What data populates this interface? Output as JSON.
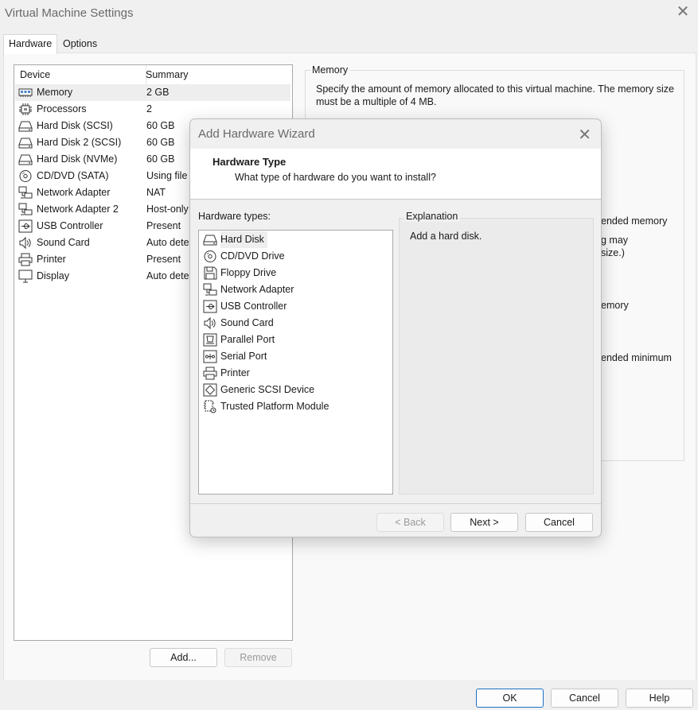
{
  "window": {
    "title": "Virtual Machine Settings"
  },
  "tabs": [
    {
      "label": "Hardware",
      "active": true
    },
    {
      "label": "Options",
      "active": false
    }
  ],
  "device_table": {
    "columns": [
      "Device",
      "Summary"
    ],
    "rows": [
      {
        "icon": "memory-icon",
        "name": "Memory",
        "summary": "2 GB",
        "selected": true
      },
      {
        "icon": "processor-icon",
        "name": "Processors",
        "summary": "2"
      },
      {
        "icon": "hard-disk-icon",
        "name": "Hard Disk (SCSI)",
        "summary": "60 GB"
      },
      {
        "icon": "hard-disk-icon",
        "name": "Hard Disk 2 (SCSI)",
        "summary": "60 GB"
      },
      {
        "icon": "hard-disk-icon",
        "name": "Hard Disk (NVMe)",
        "summary": "60 GB"
      },
      {
        "icon": "cd-dvd-icon",
        "name": "CD/DVD (SATA)",
        "summary": "Using file"
      },
      {
        "icon": "network-adapter-icon",
        "name": "Network Adapter",
        "summary": "NAT"
      },
      {
        "icon": "network-adapter-icon",
        "name": "Network Adapter 2",
        "summary": "Host-only"
      },
      {
        "icon": "usb-icon",
        "name": "USB Controller",
        "summary": "Present"
      },
      {
        "icon": "sound-icon",
        "name": "Sound Card",
        "summary": "Auto dete"
      },
      {
        "icon": "printer-icon",
        "name": "Printer",
        "summary": "Present"
      },
      {
        "icon": "display-icon",
        "name": "Display",
        "summary": "Auto dete"
      }
    ],
    "add_label": "Add...",
    "remove_label": "Remove"
  },
  "memory_panel": {
    "title": "Memory",
    "description": "Specify the amount of memory allocated to this virtual machine. The memory size must be a multiple of 4 MB.",
    "fragments": [
      "ended memory",
      "g may",
      "size.)",
      "emory",
      "ended minimum"
    ]
  },
  "footer": {
    "ok_label": "OK",
    "cancel_label": "Cancel",
    "help_label": "Help"
  },
  "wizard": {
    "title": "Add Hardware Wizard",
    "heading": "Hardware Type",
    "subheading": "What type of hardware do you want to install?",
    "types_label": "Hardware types:",
    "types": [
      {
        "icon": "hard-disk-icon",
        "name": "Hard Disk",
        "selected": true
      },
      {
        "icon": "cd-dvd-icon",
        "name": "CD/DVD Drive"
      },
      {
        "icon": "floppy-icon",
        "name": "Floppy Drive"
      },
      {
        "icon": "network-adapter-icon",
        "name": "Network Adapter"
      },
      {
        "icon": "usb-icon",
        "name": "USB Controller"
      },
      {
        "icon": "sound-icon",
        "name": "Sound Card"
      },
      {
        "icon": "parallel-port-icon",
        "name": "Parallel Port"
      },
      {
        "icon": "serial-port-icon",
        "name": "Serial Port"
      },
      {
        "icon": "printer-icon",
        "name": "Printer"
      },
      {
        "icon": "scsi-icon",
        "name": "Generic SCSI Device"
      },
      {
        "icon": "tpm-icon",
        "name": "Trusted Platform Module"
      }
    ],
    "explanation_title": "Explanation",
    "explanation_text": "Add a hard disk.",
    "back_label": "< Back",
    "next_label": "Next >",
    "cancel_label": "Cancel"
  }
}
